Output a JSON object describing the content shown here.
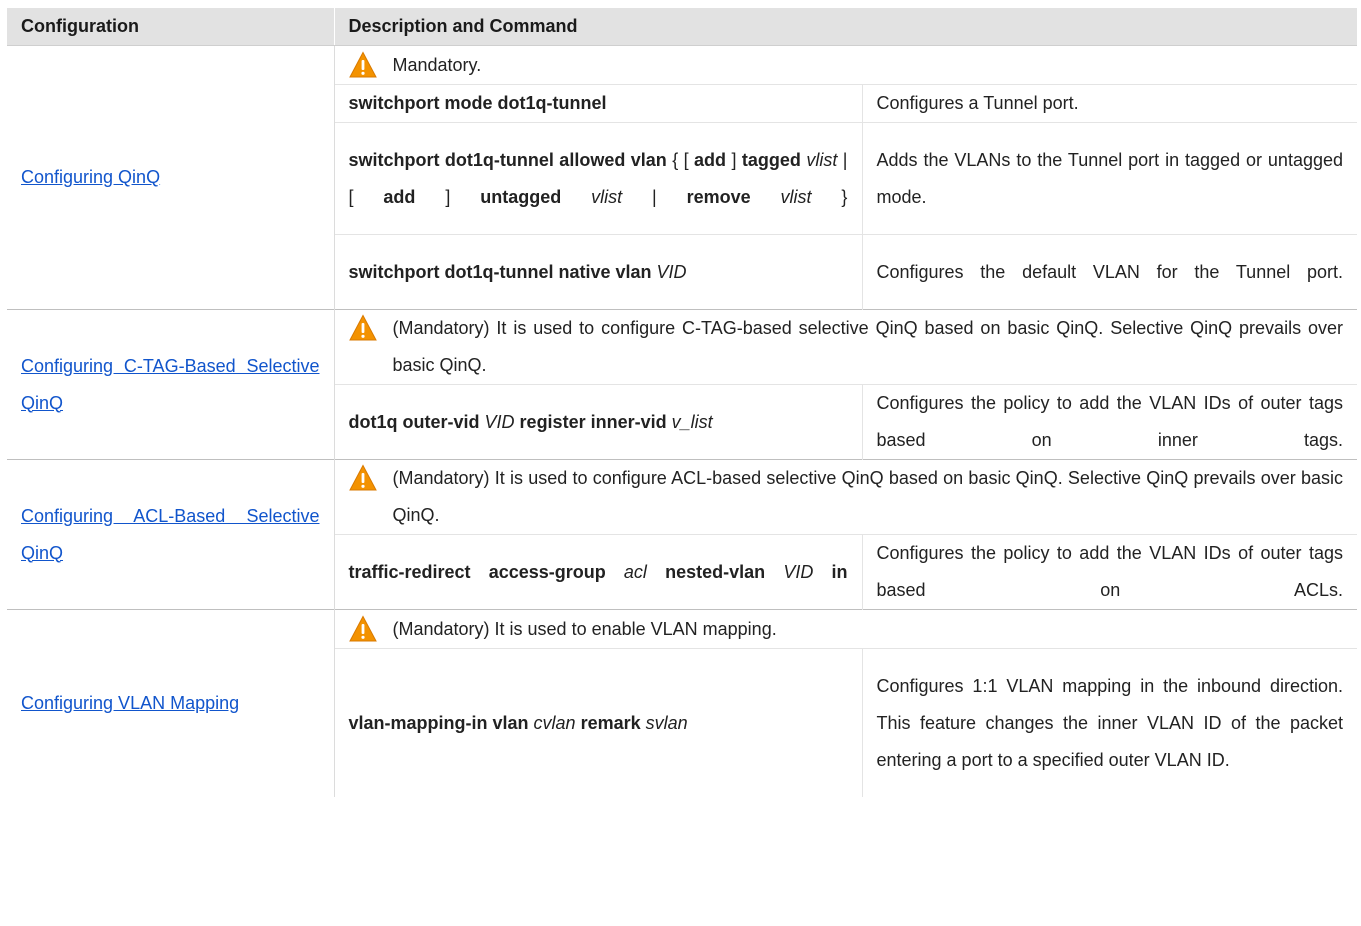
{
  "header": {
    "col1": "Configuration",
    "col2": "Description and Command"
  },
  "sections": [
    {
      "link": "Configuring QinQ",
      "notice": "Mandatory.",
      "rows": [
        {
          "cmd": "switchport mode dot1q-tunnel",
          "desc": "Configures a Tunnel port."
        },
        {
          "cmd_parts": [
            "switchport dot1q-tunnel allowed vlan",
            "{ [",
            "add",
            "]",
            "tagged",
            "vlist",
            "| [",
            "add",
            "]",
            "untagged",
            "vlist",
            "|",
            "remove",
            "vlist",
            "}"
          ],
          "desc": "Adds the VLANs to the Tunnel port in tagged or untagged mode."
        },
        {
          "cmd_parts": [
            "switchport dot1q-tunnel native vlan",
            "VID"
          ],
          "desc": "Configures the default VLAN for the Tunnel port."
        }
      ]
    },
    {
      "link": "Configuring C-TAG-Based Selective QinQ",
      "notice": "(Mandatory) It is used to configure C-TAG-based selective QinQ based on basic QinQ. Selective QinQ prevails over basic QinQ.",
      "rows": [
        {
          "cmd_parts": [
            "dot1q outer-vid",
            "VID",
            "register inner-vid",
            "v_list"
          ],
          "desc": "Configures the policy to add the VLAN IDs of outer tags based on inner tags."
        }
      ]
    },
    {
      "link": "Configuring ACL-Based Selective QinQ",
      "notice": "(Mandatory) It is used to configure ACL-based selective QinQ based on basic QinQ. Selective QinQ prevails over basic QinQ.",
      "rows": [
        {
          "cmd_parts": [
            "traffic-redirect access-group",
            "acl",
            "nested-vlan",
            "VID",
            "in"
          ],
          "desc": "Configures the policy to add the VLAN IDs of outer tags based on ACLs."
        }
      ]
    },
    {
      "link": "Configuring VLAN Mapping",
      "notice": "(Mandatory) It is used to enable VLAN mapping.",
      "rows": [
        {
          "cmd_parts": [
            "vlan-mapping-in vlan",
            "cvlan",
            "remark",
            "svlan"
          ],
          "desc": "Configures 1:1 VLAN mapping in the inbound direction. This feature changes the inner VLAN ID of the packet entering a port to a specified outer VLAN ID."
        }
      ]
    }
  ],
  "icons": {
    "warning": "warning-triangle-icon"
  },
  "colors": {
    "header_bg": "#e2e2e2",
    "link": "#1155cc",
    "warning_fill": "#f39200"
  }
}
